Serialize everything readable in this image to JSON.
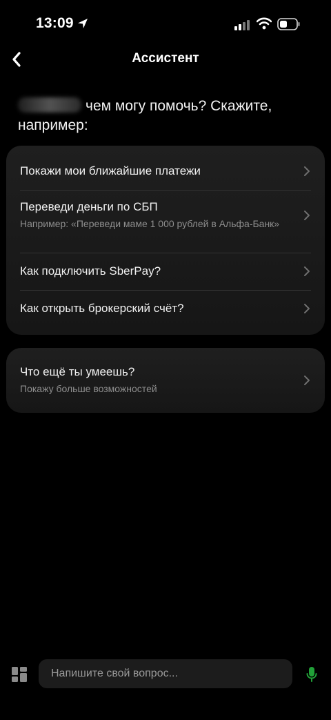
{
  "status_bar": {
    "time": "13:09"
  },
  "nav": {
    "title": "Ассистент"
  },
  "greeting": {
    "text": "чем могу помочь? Скажите, например:"
  },
  "suggestions": [
    {
      "title": "Покажи мои ближайшие платежи",
      "subtitle": ""
    },
    {
      "title": "Переведи деньги по СБП",
      "subtitle": "Например: «Переведи маме 1 000 рублей в Альфа-Банк»"
    },
    {
      "title": "Как подключить SberPay?",
      "subtitle": ""
    },
    {
      "title": "Как открыть брокерский счёт?",
      "subtitle": ""
    }
  ],
  "more": {
    "title": "Что ещё ты умеешь?",
    "subtitle": "Покажу больше возможностей"
  },
  "input": {
    "placeholder": "Напишите свой вопрос..."
  },
  "colors": {
    "background": "#000000",
    "card": "#1b1b1b",
    "mic": "#21a038"
  },
  "icons": [
    "location-arrow-icon",
    "cellular-signal-icon",
    "wifi-icon",
    "battery-icon",
    "back-chevron-icon",
    "chevron-right-icon",
    "grid-menu-icon",
    "microphone-icon"
  ]
}
